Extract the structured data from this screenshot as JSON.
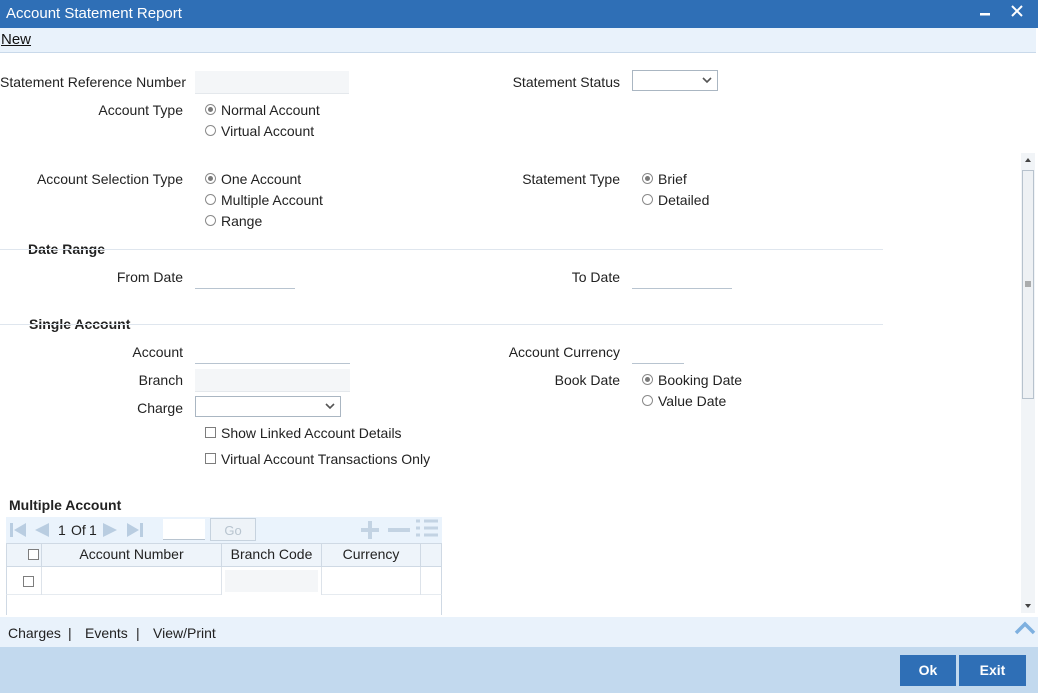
{
  "window": {
    "title": "Account Statement Report",
    "minimize_icon": "minimize-icon",
    "close_icon": "close-icon"
  },
  "menu": {
    "new_label": "New"
  },
  "form": {
    "stmt_ref_label": "Statement Reference Number",
    "stmt_ref_value": "",
    "stmt_status_label": "Statement Status",
    "stmt_status_value": "",
    "account_type_label": "Account Type",
    "account_type_options": [
      "Normal Account",
      "Virtual Account"
    ],
    "account_type_selected": "Normal Account",
    "acct_sel_label": "Account Selection Type",
    "acct_sel_options": [
      "One Account",
      "Multiple Account",
      "Range"
    ],
    "acct_sel_selected": "One Account",
    "stmt_type_label": "Statement Type",
    "stmt_type_options": [
      "Brief",
      "Detailed"
    ],
    "stmt_type_selected": "Brief"
  },
  "date_range": {
    "title": "Date Range",
    "from_label": "From Date",
    "from_value": "",
    "to_label": "To Date",
    "to_value": ""
  },
  "single_account": {
    "title": "Single Account",
    "account_label": "Account",
    "branch_label": "Branch",
    "charge_label": "Charge",
    "currency_label": "Account Currency",
    "book_date_label": "Book Date",
    "book_date_options": [
      "Booking Date",
      "Value Date"
    ],
    "book_date_selected": "Booking Date",
    "show_linked_label": "Show Linked Account Details",
    "virtual_only_label": "Virtual Account Transactions Only"
  },
  "multiple_account": {
    "title": "Multiple Account",
    "pager": {
      "current": "1",
      "of_label": "Of",
      "total": "1",
      "go_label": "Go"
    },
    "columns": [
      "Account Number",
      "Branch Code",
      "Currency"
    ],
    "rows": [
      {
        "account_number": "",
        "branch_code": "",
        "currency": ""
      }
    ]
  },
  "bottom_links": {
    "charges": "Charges",
    "sep1": "|",
    "events": "Events",
    "sep2": "|",
    "view_print": "View/Print"
  },
  "buttons": {
    "ok": "Ok",
    "exit": "Exit"
  },
  "colors": {
    "titlebar": "#2f6fb6",
    "footer": "#c2d9ee",
    "button": "#2f6fb6",
    "menubar": "#e9f2fb"
  }
}
